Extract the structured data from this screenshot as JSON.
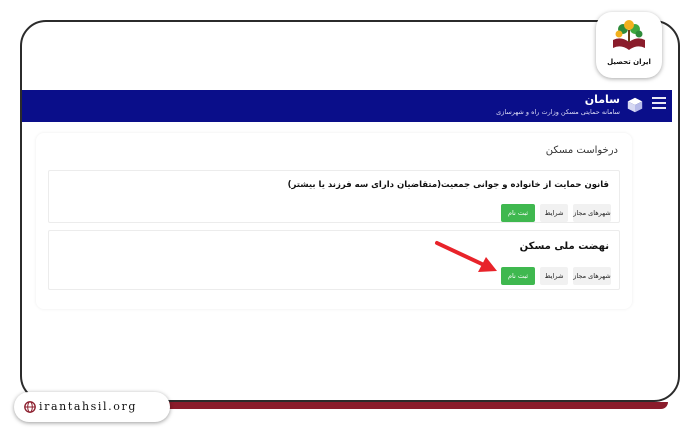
{
  "header": {
    "title": "سامان",
    "subtitle": "سامانه حمایتی مسکن وزارت راه و شهرسازی"
  },
  "panel": {
    "title": "درخواست مسکن"
  },
  "cards": [
    {
      "title": "قانون حمایت از خانواده و جوانی جمعیت(متقاضیان دارای سه فرزند یا بیشتر)",
      "cities_label": "شهرهای مجاز",
      "terms_label": "شرایط",
      "register_label": "ثبت نام"
    },
    {
      "title": "نهضت ملی مسکن",
      "cities_label": "شهرهای مجاز",
      "terms_label": "شرایط",
      "register_label": "ثبت نام"
    }
  ],
  "brand": {
    "logo_text": "ایران تحصیل",
    "url": "irantahsil.org"
  },
  "colors": {
    "header_bg": "#0a0e8a",
    "register_green": "#3fb84f",
    "annotation_red": "#e8232a",
    "strip_maroon": "#8a1c2b"
  }
}
